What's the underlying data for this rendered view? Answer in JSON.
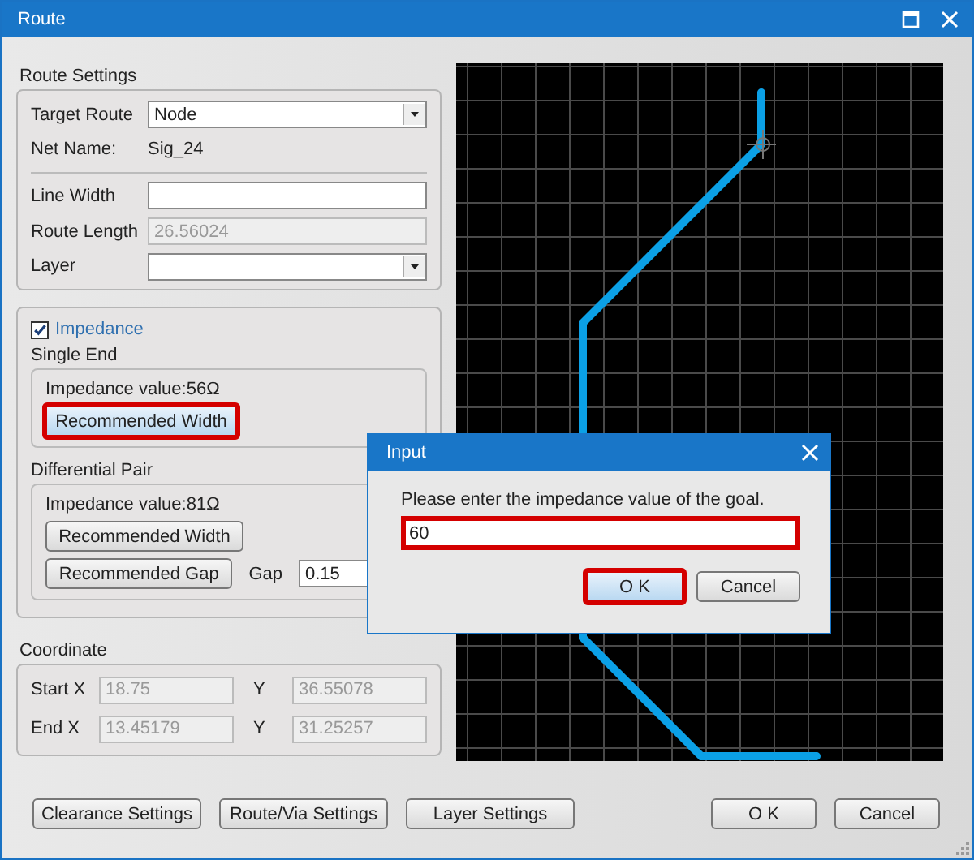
{
  "window": {
    "title": "Route"
  },
  "route_settings": {
    "title": "Route Settings",
    "target_route": {
      "label": "Target Route",
      "value": "Node"
    },
    "net_name": {
      "label": "Net Name:",
      "value": "Sig_24"
    },
    "line_width": {
      "label": "Line Width"
    },
    "route_length": {
      "label": "Route Length",
      "value": "26.56024",
      "disabled": true
    },
    "layer": {
      "label": "Layer"
    }
  },
  "impedance": {
    "label": "Impedance",
    "checked": true,
    "single_end": {
      "title": "Single End",
      "value_text": "Impedance value:56Ω",
      "buttons": [
        {
          "label": "Recommended Width",
          "highlighted": true
        }
      ]
    },
    "differential_pair": {
      "title": "Differential Pair",
      "value_text": "Impedance value:81Ω",
      "buttons": [
        {
          "label": "Recommended Width",
          "highlighted": false
        },
        {
          "label": "Recommended Gap",
          "highlighted": false
        }
      ],
      "gap": {
        "label": "Gap",
        "value": "0.15"
      }
    }
  },
  "coordinate": {
    "title": "Coordinate",
    "rows": [
      {
        "x_label": "Start X",
        "x_value": "18.75",
        "y_label": "Y",
        "y_value": "36.55078",
        "disabled": true
      },
      {
        "x_label": "End X",
        "x_value": "13.45179",
        "y_label": "Y",
        "y_value": "31.25257",
        "disabled": true
      }
    ]
  },
  "left_buttons": [
    {
      "label": "Clearance Settings"
    },
    {
      "label": "Route/Via Settings"
    },
    {
      "label": "Layer Settings"
    }
  ],
  "right_buttons": [
    {
      "label": "O K"
    },
    {
      "label": "Cancel"
    }
  ],
  "dialog": {
    "title": "Input",
    "prompt": "Please enter the impedance value of the goal.",
    "field": {
      "value": "60",
      "highlighted": true
    },
    "buttons": [
      {
        "label": "O K",
        "highlighted": true
      },
      {
        "label": "Cancel",
        "highlighted": false
      }
    ]
  }
}
